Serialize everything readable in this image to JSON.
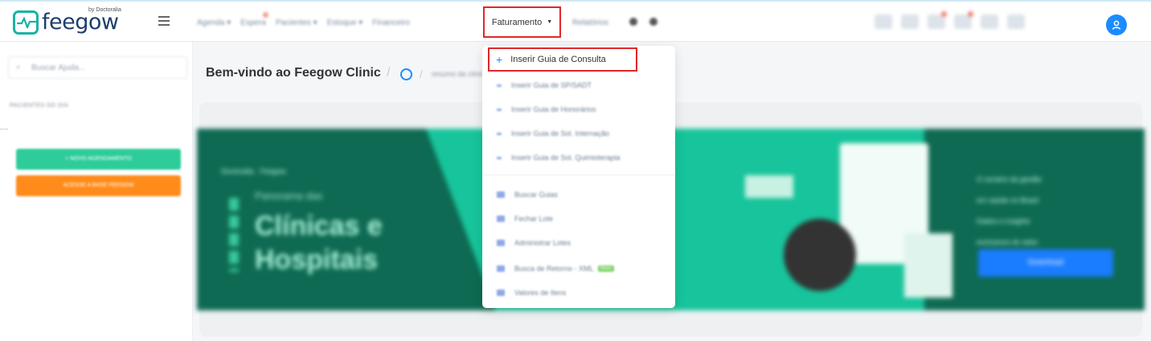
{
  "brand": {
    "name": "feegow",
    "by": "by Doctoralia"
  },
  "nav": {
    "items": [
      {
        "label": "Agenda",
        "has_badge": false
      },
      {
        "label": "Espera",
        "has_badge": true
      },
      {
        "label": "Pacientes",
        "has_badge": false
      },
      {
        "label": "Estoque",
        "has_badge": false
      },
      {
        "label": "Financeiro",
        "has_badge": false
      }
    ],
    "active_label": "Faturamento",
    "after_items": [
      {
        "label": "Relatórios"
      }
    ]
  },
  "sidebar": {
    "search_placeholder": "Buscar Ajuda...",
    "section_label": "PACIENTES DO DIA",
    "btn_green": "+ NOVO AGENDAMENTO",
    "btn_orange": "ACESSE A BASE FEEGOW"
  },
  "main": {
    "title": "Bem-vindo ao Feegow Clinic",
    "crumb": "resumo da clínica"
  },
  "banner": {
    "logos": "Doctoralia  ·  Feegow",
    "subtitle": "Panorama das",
    "big1": "Clínicas e",
    "big2": "Hospitais",
    "list1": "O cenário da gestão",
    "list1b": "em saúde no Brasil",
    "list2": "Dados e insights",
    "list2b": "exclusivos do setor",
    "cta": "Download"
  },
  "dropdown": {
    "first": "Inserir Guia de Consulta",
    "items": [
      {
        "label": "Inserir Guia de SP/SADT",
        "new": false
      },
      {
        "label": "Inserir Guia de Honorários",
        "new": false
      },
      {
        "label": "Inserir Guia de Sol. Internação",
        "new": false
      },
      {
        "label": "Inserir Guia de Sol. Quimioterapia",
        "new": false
      },
      {
        "label": "Buscar Guias",
        "new": false
      },
      {
        "label": "Fechar Lote",
        "new": false
      },
      {
        "label": "Administrar Lotes",
        "new": false
      },
      {
        "label": "Busca de Retorno - XML",
        "new": true,
        "new_label": "Novo"
      },
      {
        "label": "Valores de Itens",
        "new": false
      }
    ]
  },
  "colors": {
    "accent": "#1a8cff",
    "highlight": "#e0272b",
    "green": "#2dcc9a",
    "orange": "#ff8c1a",
    "banner_dark": "#0e6a52",
    "banner_mid": "#17c49b"
  }
}
